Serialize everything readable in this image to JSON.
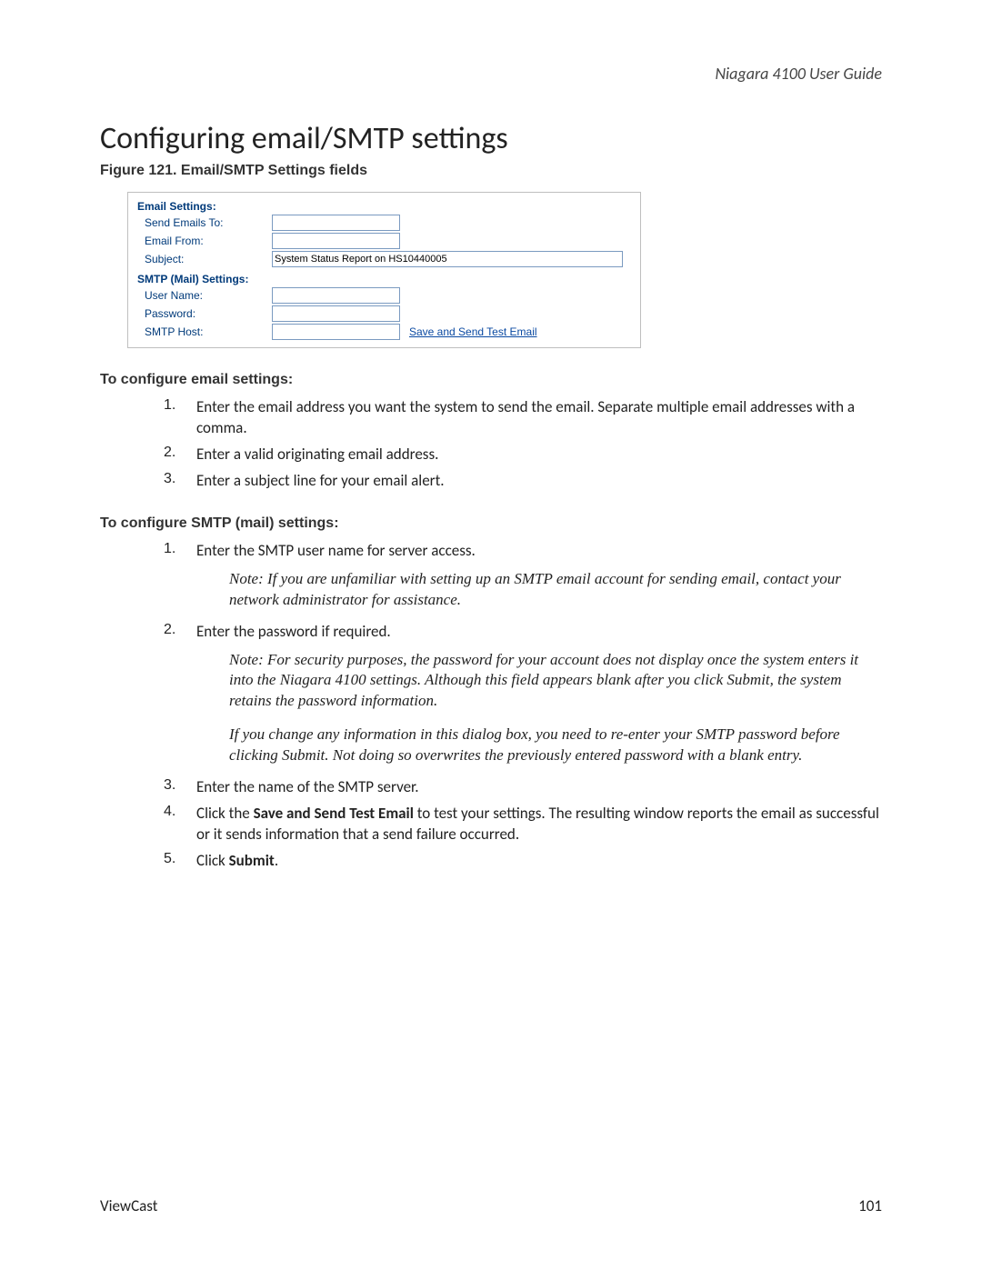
{
  "header": {
    "running": "Niagara 4100 User Guide"
  },
  "title": "Configuring email/SMTP settings",
  "figure_caption": "Figure 121. Email/SMTP Settings fields",
  "panel": {
    "group_email": "Email Settings:",
    "send_to_label": "Send Emails To:",
    "send_to_value": "",
    "from_label": "Email From:",
    "from_value": "",
    "subject_label": "Subject:",
    "subject_value": "System Status Report on HS10440005",
    "group_smtp": "SMTP (Mail) Settings:",
    "user_label": "User Name:",
    "user_value": "",
    "pass_label": "Password:",
    "pass_value": "",
    "host_label": "SMTP Host:",
    "host_value": "",
    "link": "Save and Send Test Email"
  },
  "email_section_title": "To configure email settings:",
  "email_steps": [
    "Enter the email address you want the system to send the email. Separate multiple email addresses with a comma.",
    "Enter a valid originating email address.",
    "Enter a subject line for your email alert."
  ],
  "smtp_section_title": "To configure SMTP (mail) settings:",
  "smtp_step1": "Enter the SMTP user name for server access.",
  "smtp_step1_note": "Note: If you are unfamiliar with setting up an SMTP email account for sending email, contact your network administrator for assistance.",
  "smtp_step2": "Enter the password if required.",
  "smtp_step2_note1": "Note: For security purposes, the password for your account does not display once the system enters it into the Niagara 4100 settings. Although this field appears blank after you click Submit, the system retains the password information.",
  "smtp_step2_note2": "If you change any information in this dialog box, you need to re-enter your SMTP password before clicking Submit. Not doing so overwrites the previously entered password with a blank entry.",
  "smtp_step3": "Enter the name of the SMTP server.",
  "smtp_step4_pre": "Click the ",
  "smtp_step4_bold": "Save and Send Test Email",
  "smtp_step4_post": " to test your settings. The resulting window reports the email as successful or it sends information that a send failure occurred.",
  "smtp_step5_pre": "Click ",
  "smtp_step5_bold": "Submit",
  "smtp_step5_post": ".",
  "footer": {
    "left": "ViewCast",
    "right": "101"
  }
}
